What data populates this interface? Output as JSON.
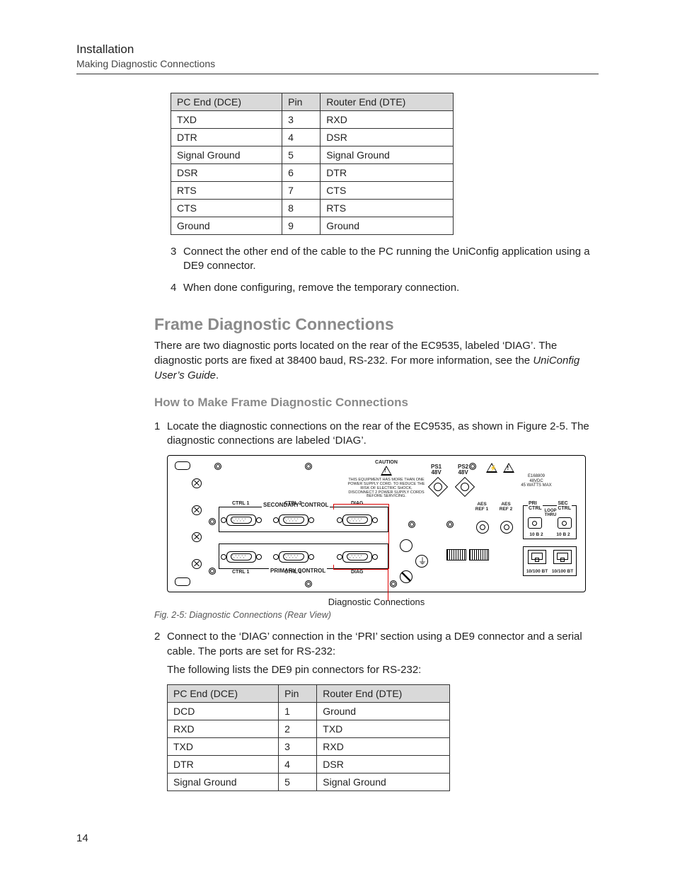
{
  "header": {
    "title": "Installation",
    "subtitle": "Making Diagnostic Connections"
  },
  "table1": {
    "headers": [
      "PC End (DCE)",
      "Pin",
      "Router End (DTE)"
    ],
    "rows": [
      [
        "TXD",
        "3",
        "RXD"
      ],
      [
        "DTR",
        "4",
        "DSR"
      ],
      [
        "Signal Ground",
        "5",
        "Signal Ground"
      ],
      [
        "DSR",
        "6",
        "DTR"
      ],
      [
        "RTS",
        "7",
        "CTS"
      ],
      [
        "CTS",
        "8",
        "RTS"
      ],
      [
        "Ground",
        "9",
        "Ground"
      ]
    ]
  },
  "steps_top": {
    "s3": "Connect the other end of the cable to the PC running the UniConfig application using a DE9 connector.",
    "s4": "When done configuring, remove the temporary connection."
  },
  "section": {
    "title": "Frame Diagnostic Connections",
    "intro_a": "There are two diagnostic ports located on the rear of the EC9535, labeled ‘DIAG’. The diagnostic ports are fixed at 38400 baud, RS-232. For more information, see the ",
    "intro_italic": "UniConfig User’s Guide",
    "intro_b": "."
  },
  "subsection": {
    "title": "How to Make Frame Diagnostic Connections",
    "s1": "Locate the diagnostic connections on the rear of the EC9535, as shown in Figure 2-5. The diagnostic connections are labeled ‘DIAG’.",
    "s2_a": "Connect to the ‘DIAG’ connection in the ‘PRI’ section using a DE9 connector and a serial cable. The ports are set for RS-232:",
    "s2_b": "The following lists the DE9 pin connectors for RS-232:"
  },
  "diagram": {
    "caution_title": "CAUTION",
    "caution_text": "THIS EQUIPMENT HAS MORE THAN ONE POWER SUPPLY CORD. TO REDUCE THE RISK OF ELECTRIC SHOCK, DISCONNECT 2 POWER SUPPLY CORDS BEFORE SERVICING.",
    "ps1": "PS1\n48V",
    "ps2": "PS2\n48V",
    "right_info": "E168809\n48VDC\n45 WATTS MAX",
    "secondary": "SECONDARY  CONTROL",
    "primary": "PRIMARY  CONTROL",
    "ctrl1": "CTRL 1",
    "ctrl2": "CTRL 2",
    "diag": "DIAG",
    "aes1": "AES\nREF 1",
    "aes2": "AES\nREF 2",
    "pri_ctrl": "PRI\nCTRL",
    "sec_ctrl": "SEC\nCTRL",
    "loop_thru": "LOOP\nTHRU",
    "tenb2": "10 B 2",
    "eth": "10/100 BT",
    "caption": "Diagnostic Connections",
    "fig": "Fig. 2-5: Diagnostic Connections (Rear View)"
  },
  "table2": {
    "headers": [
      "PC End (DCE)",
      "Pin",
      "Router End (DTE)"
    ],
    "rows": [
      [
        "DCD",
        "1",
        "Ground"
      ],
      [
        "RXD",
        "2",
        "TXD"
      ],
      [
        "TXD",
        "3",
        "RXD"
      ],
      [
        "DTR",
        "4",
        "DSR"
      ],
      [
        "Signal Ground",
        "5",
        "Signal Ground"
      ]
    ]
  },
  "page_number": "14"
}
